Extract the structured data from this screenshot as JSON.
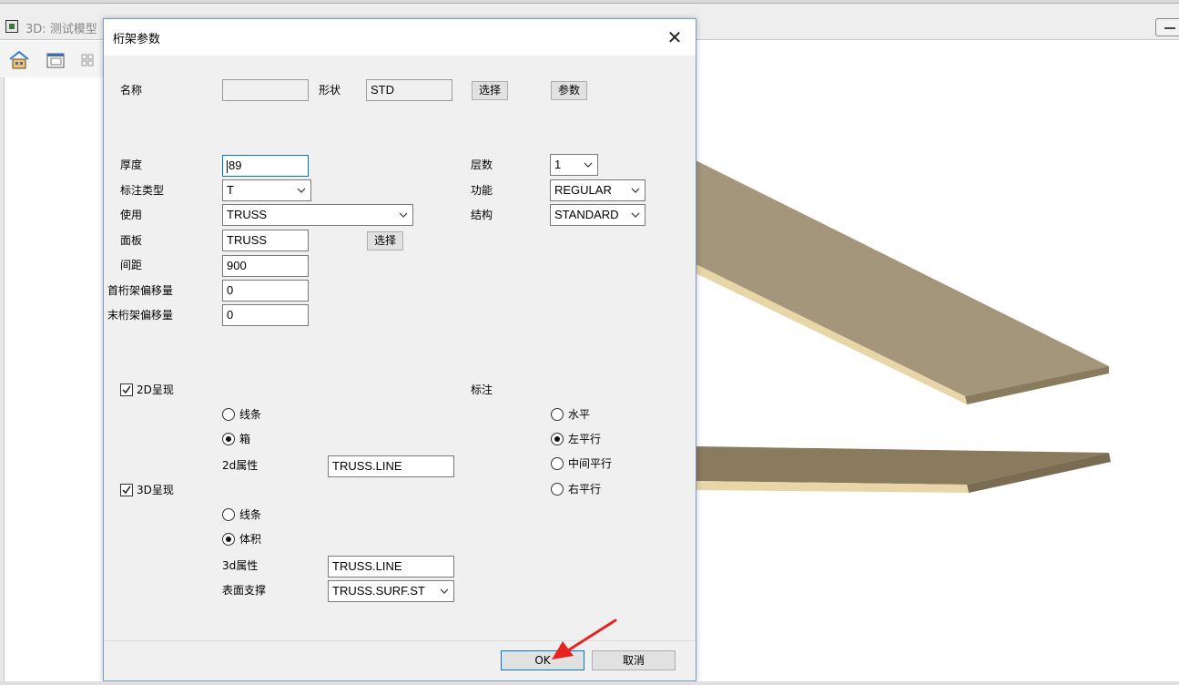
{
  "background_window": {
    "title": "3D: 测试模型"
  },
  "dialog": {
    "title": "桁架参数",
    "name_label": "名称",
    "name_value": "",
    "shape_label": "形状",
    "shape_value": "STD",
    "select_label": "选择",
    "params_label": "参数",
    "thickness_label": "厚度",
    "thickness_value": "89",
    "dim_type_label": "标注类型",
    "dim_type_value": "T",
    "use_label": "使用",
    "use_value": "TRUSS",
    "panel_label": "面板",
    "panel_value": "TRUSS",
    "panel_select_label": "选择",
    "spacing_label": "间距",
    "spacing_value": "900",
    "first_offset_label": "首桁架偏移量",
    "first_offset_value": "0",
    "last_offset_label": "末桁架偏移量",
    "last_offset_value": "0",
    "layers_label": "层数",
    "layers_value": "1",
    "function_label": "功能",
    "function_value": "REGULAR",
    "structure_label": "结构",
    "structure_value": "STANDARD",
    "show_2d_label": "2D呈现",
    "show_2d_checked": true,
    "r2d_line_label": "线条",
    "r2d_box_label": "箱",
    "r2d_selected": "箱",
    "attr_2d_label": "2d属性",
    "attr_2d_value": "TRUSS.LINE",
    "show_3d_label": "3D呈现",
    "show_3d_checked": true,
    "r3d_line_label": "线条",
    "r3d_volume_label": "体积",
    "r3d_selected": "体积",
    "attr_3d_label": "3d属性",
    "attr_3d_value": "TRUSS.LINE",
    "surface_label": "表面支撑",
    "surface_value": "TRUSS.SURF.ST",
    "annotation_label": "标注",
    "ann_horizontal_label": "水平",
    "ann_left_label": "左平行",
    "ann_middle_label": "中间平行",
    "ann_right_label": "右平行",
    "ann_selected": "左平行",
    "ok_label": "OK",
    "cancel_label": "取消"
  },
  "colors": {
    "panel_top": "#a4967a",
    "panel_edge": "#e8d6a8",
    "annotation_arrow": "#e8231f",
    "focus_border": "#0078d7"
  }
}
